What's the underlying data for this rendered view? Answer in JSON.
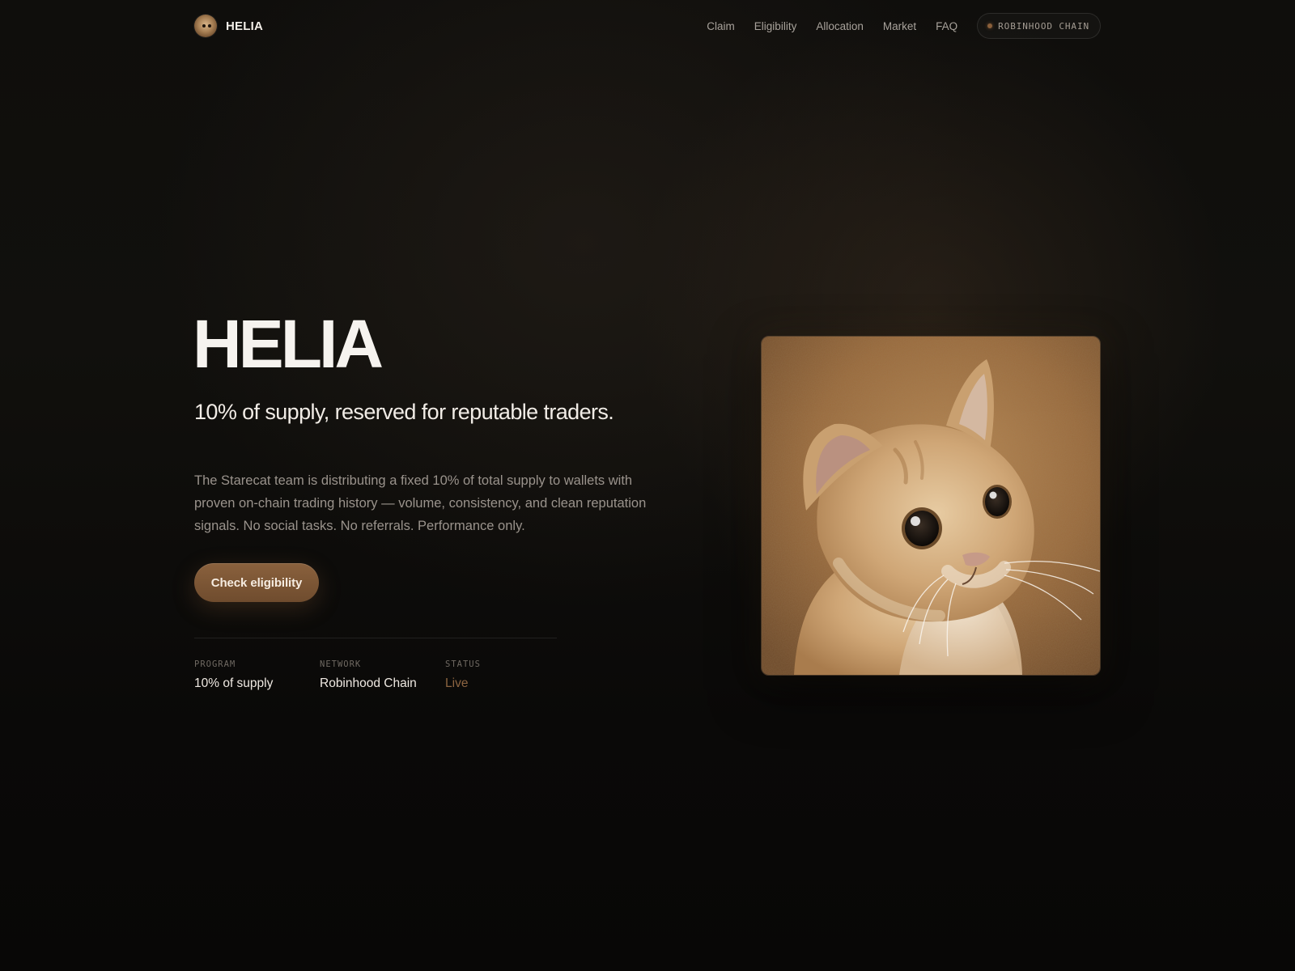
{
  "brand": {
    "name": "HELIA",
    "logo_icon": "cat-avatar-icon"
  },
  "nav": {
    "links": [
      {
        "label": "Claim"
      },
      {
        "label": "Eligibility"
      },
      {
        "label": "Allocation"
      },
      {
        "label": "Market"
      },
      {
        "label": "FAQ"
      }
    ],
    "chain_pill": {
      "label": "ROBINHOOD CHAIN",
      "status_dot_color": "#8a5f3a"
    }
  },
  "hero": {
    "title": "HELIA",
    "subtitle": "10% of supply, reserved for reputable traders.",
    "description": "The Starecat team is distributing a fixed 10% of total supply to wallets with proven on-chain trading history — volume, consistency, and clean reputation signals. No social tasks. No referrals. Performance only.",
    "cta_label": "Check eligibility",
    "image_icon": "starecat-image"
  },
  "stats": [
    {
      "label": "PROGRAM",
      "value": "10% of supply"
    },
    {
      "label": "NETWORK",
      "value": "Robinhood Chain"
    },
    {
      "label": "STATUS",
      "value": "Live"
    }
  ],
  "colors": {
    "background": "#0a0908",
    "accent": "#7a5535",
    "status_live": "#8c6440",
    "text_primary": "#f4efe9",
    "text_muted": "#9a938c"
  }
}
